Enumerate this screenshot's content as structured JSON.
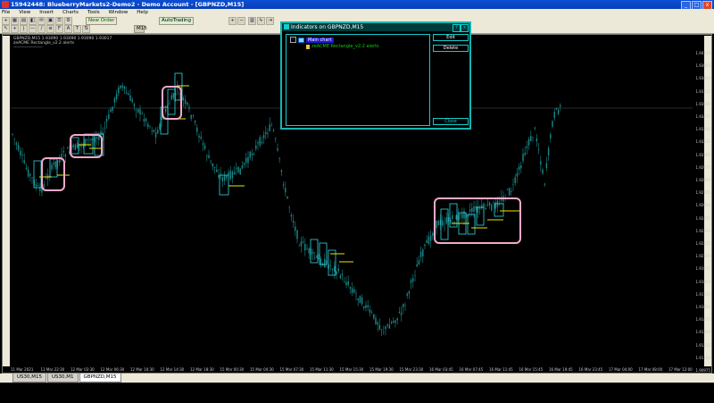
{
  "window": {
    "title": "15942448: BlueberryMarkets2-Demo2 - Demo Account - [GBPNZD,M15]",
    "controls": [
      "_",
      "□",
      "x"
    ]
  },
  "menu": [
    "File",
    "View",
    "Insert",
    "Charts",
    "Tools",
    "Window",
    "Help"
  ],
  "toolbar": {
    "new_order": "New Order",
    "autotrading": "AutoTrading",
    "timeframe": "M15"
  },
  "chart": {
    "info_line1": "GBPNZD,M15  1.93090 1.93090 1.93090 1.93017",
    "info_line2": "zeACME Rectangle_v2.2 alerts",
    "info_line3": "--------------------",
    "price_labels": [
      "1.94115",
      "1.93960",
      "1.93840",
      "1.93715",
      "1.93590",
      "1.93475",
      "1.93350",
      "1.93225",
      "1.93100",
      "1.92975",
      "1.92850",
      "1.92725",
      "1.92600",
      "1.92475",
      "1.92350",
      "1.92225",
      "1.92100",
      "1.91975",
      "1.91850",
      "1.91725",
      "1.91605",
      "1.91475",
      "1.91350",
      "1.91225",
      "1.91100",
      "1.90975"
    ],
    "time_labels": [
      "11 Mar 2021",
      "11 Mar 22:30",
      "12 Mar 02:30",
      "12 Mar 06:30",
      "12 Mar 10:30",
      "12 Mar 14:30",
      "12 Mar 18:30",
      "15 Mar 00:30",
      "15 Mar 04:30",
      "15 Mar 07:30",
      "15 Mar 11:30",
      "15 Mar 15:30",
      "15 Mar 19:30",
      "15 Mar 23:30",
      "16 Mar 03:45",
      "16 Mar 07:45",
      "16 Mar 11:45",
      "16 Mar 15:45",
      "16 Mar 19:45",
      "16 Mar 23:45",
      "17 Mar 04:00",
      "17 Mar 08:00",
      "17 Mar 12:00"
    ],
    "colors": {
      "candle": "#1a8c8c",
      "rectangle": "#2fd8e0",
      "signal": "#e8e800",
      "highlight": "#f4a9c8"
    }
  },
  "tabs": [
    {
      "label": "US30,M15",
      "active": false
    },
    {
      "label": "US30,M1",
      "active": false
    },
    {
      "label": "GBPNZD,M15",
      "active": true
    }
  ],
  "dialog": {
    "title": "Indicators on GBPNZD,M15",
    "help": "?",
    "close_x": "x",
    "tree_main": "Main chart",
    "tree_item": "zeACME Rectangle_v2.2 alerts",
    "buttons": {
      "edit": "Edit",
      "delete": "Delete",
      "close": "Close"
    }
  }
}
